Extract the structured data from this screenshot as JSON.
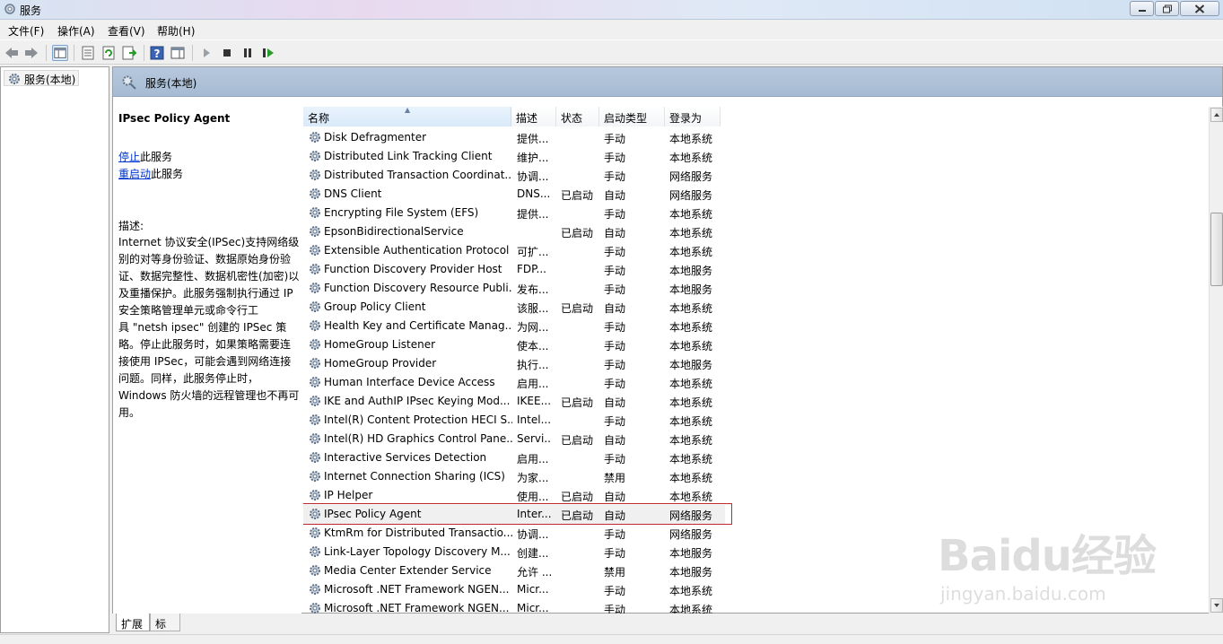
{
  "window": {
    "title": "服务"
  },
  "menu": [
    {
      "label": "文件(F)"
    },
    {
      "label": "操作(A)"
    },
    {
      "label": "查看(V)"
    },
    {
      "label": "帮助(H)"
    }
  ],
  "toolbar": {
    "icons": [
      "back-arrow-icon",
      "forward-arrow-icon",
      "console-tree-icon",
      "properties-icon",
      "refresh-icon",
      "export-list-icon",
      "help-icon",
      "action-pane-icon",
      "play-icon",
      "stop-icon",
      "pause-icon",
      "restart-icon"
    ]
  },
  "tree": {
    "root_label": "服务(本地)"
  },
  "panel": {
    "header_title": "服务(本地)",
    "selected_service": "IPsec Policy Agent",
    "stop_link": "停止",
    "stop_suffix": "此服务",
    "restart_link": "重启动",
    "restart_suffix": "此服务",
    "desc_label": "描述:",
    "desc_lines": [
      "Internet 协议安全(IPSec)支持网络级",
      "别的对等身份验证、数据原始身份验",
      "证、数据完整性、数据机密性(加密)以",
      "及重播保护。此服务强制执行通过 IP",
      "安全策略管理单元或命令行工",
      "具 \"netsh ipsec\" 创建的 IPSec 策",
      "略。停止此服务时，如果策略需要连",
      "接使用 IPSec，可能会遇到网络连接",
      "问题。同样，此服务停止时，",
      "Windows 防火墙的远程管理也不再可",
      "用。"
    ]
  },
  "columns": {
    "name": "名称",
    "desc": "描述",
    "status": "状态",
    "type": "启动类型",
    "logon": "登录为"
  },
  "services": [
    {
      "name": "Disk Defragmenter",
      "desc": "提供...",
      "status": "",
      "type": "手动",
      "logon": "本地系统"
    },
    {
      "name": "Distributed Link Tracking Client",
      "desc": "维护...",
      "status": "",
      "type": "手动",
      "logon": "本地系统"
    },
    {
      "name": "Distributed Transaction Coordinat...",
      "desc": "协调...",
      "status": "",
      "type": "手动",
      "logon": "网络服务"
    },
    {
      "name": "DNS Client",
      "desc": "DNS...",
      "status": "已启动",
      "type": "自动",
      "logon": "网络服务"
    },
    {
      "name": "Encrypting File System (EFS)",
      "desc": "提供...",
      "status": "",
      "type": "手动",
      "logon": "本地系统"
    },
    {
      "name": "EpsonBidirectionalService",
      "desc": "",
      "status": "已启动",
      "type": "自动",
      "logon": "本地系统"
    },
    {
      "name": "Extensible Authentication Protocol",
      "desc": "可扩...",
      "status": "",
      "type": "手动",
      "logon": "本地系统"
    },
    {
      "name": "Function Discovery Provider Host",
      "desc": "FDP...",
      "status": "",
      "type": "手动",
      "logon": "本地服务"
    },
    {
      "name": "Function Discovery Resource Publi...",
      "desc": "发布...",
      "status": "",
      "type": "手动",
      "logon": "本地服务"
    },
    {
      "name": "Group Policy Client",
      "desc": "该服...",
      "status": "已启动",
      "type": "自动",
      "logon": "本地系统"
    },
    {
      "name": "Health Key and Certificate Manag...",
      "desc": "为网...",
      "status": "",
      "type": "手动",
      "logon": "本地系统"
    },
    {
      "name": "HomeGroup Listener",
      "desc": "使本...",
      "status": "",
      "type": "手动",
      "logon": "本地系统"
    },
    {
      "name": "HomeGroup Provider",
      "desc": "执行...",
      "status": "",
      "type": "手动",
      "logon": "本地服务"
    },
    {
      "name": "Human Interface Device Access",
      "desc": "启用...",
      "status": "",
      "type": "手动",
      "logon": "本地系统"
    },
    {
      "name": "IKE and AuthIP IPsec Keying Mod...",
      "desc": "IKEE...",
      "status": "已启动",
      "type": "自动",
      "logon": "本地系统"
    },
    {
      "name": "Intel(R) Content Protection HECI S...",
      "desc": "Intel...",
      "status": "",
      "type": "手动",
      "logon": "本地系统"
    },
    {
      "name": "Intel(R) HD Graphics Control Pane...",
      "desc": "Servi...",
      "status": "已启动",
      "type": "自动",
      "logon": "本地系统"
    },
    {
      "name": "Interactive Services Detection",
      "desc": "启用...",
      "status": "",
      "type": "手动",
      "logon": "本地系统"
    },
    {
      "name": "Internet Connection Sharing (ICS)",
      "desc": "为家...",
      "status": "",
      "type": "禁用",
      "logon": "本地系统"
    },
    {
      "name": "IP Helper",
      "desc": "使用...",
      "status": "已启动",
      "type": "自动",
      "logon": "本地系统"
    },
    {
      "name": "IPsec Policy Agent",
      "desc": "Inter...",
      "status": "已启动",
      "type": "自动",
      "logon": "网络服务"
    },
    {
      "name": "KtmRm for Distributed Transactio...",
      "desc": "协调...",
      "status": "",
      "type": "手动",
      "logon": "网络服务"
    },
    {
      "name": "Link-Layer Topology Discovery M...",
      "desc": "创建...",
      "status": "",
      "type": "手动",
      "logon": "本地服务"
    },
    {
      "name": "Media Center Extender Service",
      "desc": "允许 ...",
      "status": "",
      "type": "禁用",
      "logon": "本地服务"
    },
    {
      "name": "Microsoft .NET Framework NGEN...",
      "desc": "Micr...",
      "status": "",
      "type": "手动",
      "logon": "本地系统"
    },
    {
      "name": "Microsoft .NET Framework NGEN...",
      "desc": "Micr...",
      "status": "",
      "type": "手动",
      "logon": "本地系统"
    }
  ],
  "tabs": {
    "extended": "扩展",
    "standard": "标准"
  },
  "watermark": {
    "logo": "Baidu经验",
    "url": "jingyan.baidu.com"
  }
}
